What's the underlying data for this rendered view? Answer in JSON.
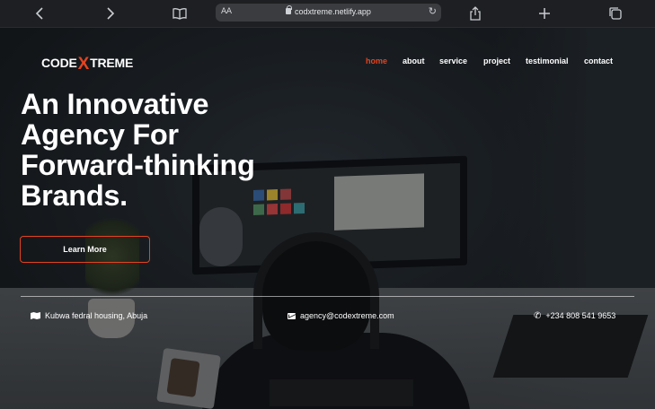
{
  "browser": {
    "url": "codxtreme.netlify.app",
    "text_size_label": "AA",
    "icons": {
      "back": "chevron-left-icon",
      "forward": "chevron-right-icon",
      "bookmarks": "book-icon",
      "reload": "reload-icon",
      "share": "share-icon",
      "new_tab": "plus-icon",
      "tabs": "tabs-icon"
    }
  },
  "logo": {
    "part1": "CODE",
    "x": "X",
    "part2": "TREME"
  },
  "nav": {
    "items": [
      {
        "label": "home",
        "active": true
      },
      {
        "label": "about",
        "active": false
      },
      {
        "label": "service",
        "active": false
      },
      {
        "label": "project",
        "active": false
      },
      {
        "label": "testimonial",
        "active": false
      },
      {
        "label": "contact",
        "active": false
      }
    ]
  },
  "hero": {
    "headline_lines": [
      "An Innovative",
      "Agency For",
      "Forward-thinking",
      "Brands."
    ],
    "cta_label": "Learn More"
  },
  "contact": {
    "address": "Kubwa fedral housing, Abuja",
    "email": "agency@codextreme.com",
    "phone": "+234 808 541 9653"
  },
  "colors": {
    "accent": "#e5431e",
    "text": "#ffffff",
    "background": "#1b1d20"
  }
}
